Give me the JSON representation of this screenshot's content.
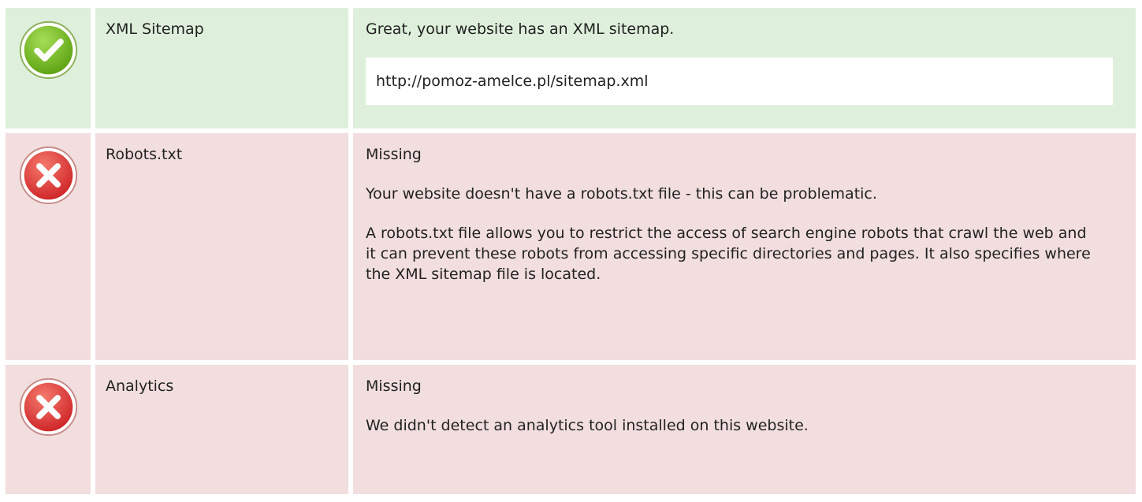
{
  "rows": [
    {
      "status": "pass",
      "icon": "check-circle-icon",
      "name": "XML Sitemap",
      "description": "Great, your website has an XML sitemap.",
      "url": "http://pomoz-amelce.pl/sitemap.xml"
    },
    {
      "status": "fail",
      "icon": "x-circle-icon",
      "name": "Robots.txt",
      "status_label": "Missing",
      "description": "Your website doesn't have a robots.txt file - this can be problematic.",
      "details": "A robots.txt file allows you to restrict the access of search engine robots that crawl the web and it can prevent these robots from accessing specific directories and pages. It also specifies where the XML sitemap file is located."
    },
    {
      "status": "fail",
      "icon": "x-circle-icon",
      "name": "Analytics",
      "status_label": "Missing",
      "description": "We didn't detect an analytics tool installed on this website."
    }
  ],
  "colors": {
    "pass_background": "#def0db",
    "fail_background": "#f2dede",
    "pass_icon": "#76bc21",
    "fail_icon": "#e13b3b"
  }
}
